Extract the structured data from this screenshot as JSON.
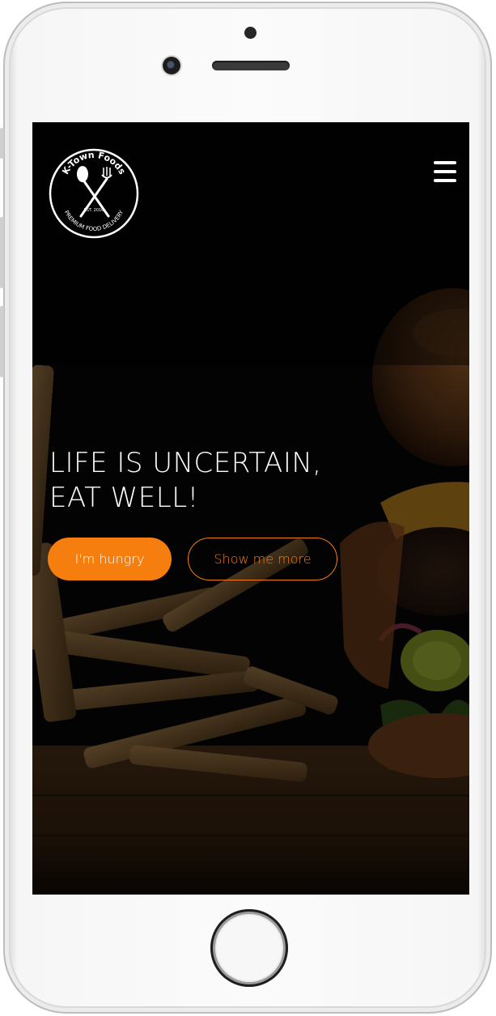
{
  "brand": {
    "logo_text_top": "K-Town Foods",
    "logo_text_bottom": "PREMIUM FOOD DELIVERY",
    "logo_est": "EST. 2016"
  },
  "hero": {
    "headline_line1": "LIFE IS UNCERTAIN,",
    "headline_line2": "EAT WELL!",
    "primary_button": "I'm hungry",
    "secondary_button": "Show me more"
  },
  "colors": {
    "accent": "#f57e0e",
    "text": "#ffffff",
    "background": "#050505"
  },
  "icons": {
    "menu": "hamburger-menu-icon",
    "logo": "crossed-spoon-fork-icon"
  }
}
